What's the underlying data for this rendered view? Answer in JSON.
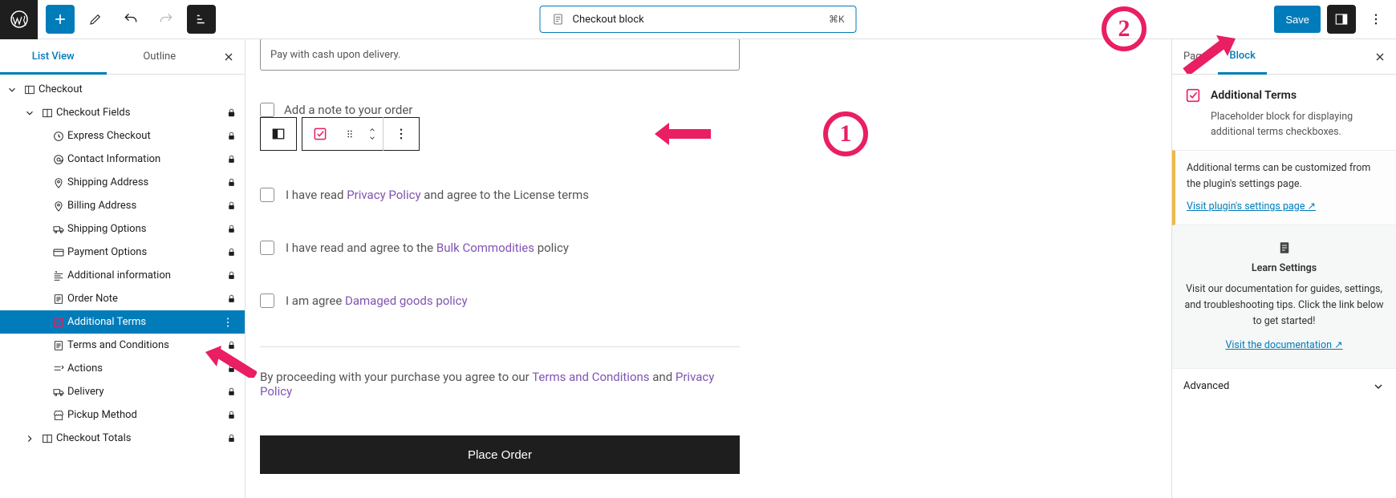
{
  "topbar": {
    "center_label": "Checkout block",
    "center_kbd": "⌘K",
    "save": "Save"
  },
  "left_tabs": {
    "list_view": "List View",
    "outline": "Outline"
  },
  "tree": {
    "checkout": "Checkout",
    "checkout_fields": "Checkout Fields",
    "items": [
      "Express Checkout",
      "Contact Information",
      "Shipping Address",
      "Billing Address",
      "Shipping Options",
      "Payment Options",
      "Additional information",
      "Order Note",
      "Additional Terms",
      "Terms and Conditions",
      "Actions",
      "Delivery",
      "Pickup Method"
    ],
    "checkout_totals": "Checkout Totals"
  },
  "canvas": {
    "pay_placeholder": "Pay with cash upon delivery.",
    "add_note": "Add a note to your order",
    "term1_pre": "I have read ",
    "term1_link": "Privacy Policy",
    "term1_post": " and agree to the License terms",
    "term2_pre": "I have read and agree to the ",
    "term2_link": "Bulk Commodities",
    "term2_post": " policy",
    "term3_pre": "I am agree ",
    "term3_link": "Damaged goods policy",
    "proceed_pre": "By proceeding with your purchase you agree to our ",
    "proceed_link1": "Terms and Conditions",
    "proceed_mid": " and ",
    "proceed_link2": "Privacy Policy",
    "place_order": "Place Order"
  },
  "right": {
    "tab_page": "Page",
    "tab_block": "Block",
    "title": "Additional Terms",
    "desc": "Placeholder block for displaying additional terms checkboxes.",
    "notice_text": "Additional terms can be customized from the plugin's settings page.",
    "notice_link": "Visit plugin's settings page",
    "learn_title": "Learn Settings",
    "learn_body": "Visit our documentation for guides, settings, and troubleshooting tips. Click the link below to get started!",
    "learn_link": "Visit the documentation",
    "advanced": "Advanced"
  },
  "anno": {
    "one": "1",
    "two": "2"
  }
}
